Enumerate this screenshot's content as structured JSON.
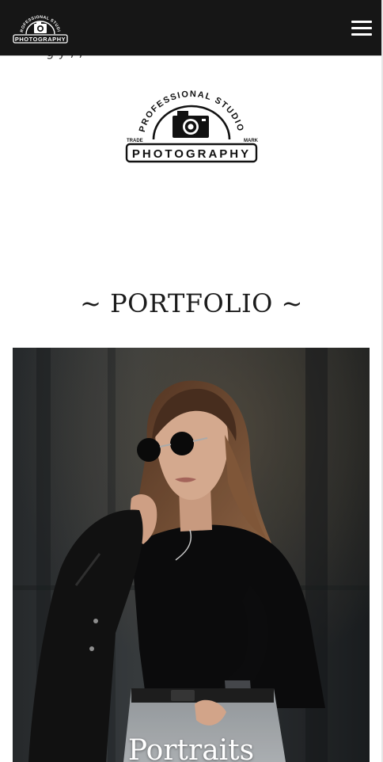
{
  "header": {
    "logo_arc_text": "PROFESSIONAL STUDIO",
    "logo_word": "PHOTOGRAPHY",
    "menu_icon": "hamburger-icon"
  },
  "intro": {
    "partial_text": "g y ; ,"
  },
  "brand": {
    "arc_text": "PROFESSIONAL STUDIO",
    "word": "PHOTOGRAPHY",
    "left_tag": "TRADE",
    "right_tag": "MARK"
  },
  "portfolio": {
    "heading": "~ PORTFOLIO ~",
    "items": [
      {
        "label": "Portraits"
      }
    ]
  }
}
